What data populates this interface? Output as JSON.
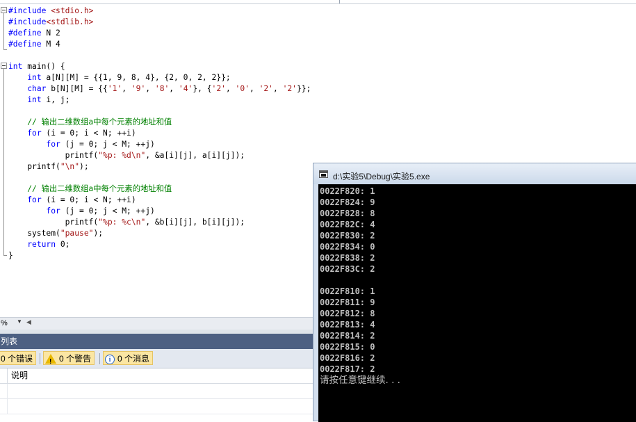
{
  "editor": {
    "lines": [
      [
        {
          "t": "#include ",
          "c": "pp"
        },
        {
          "t": "<stdio.h>",
          "c": "str"
        }
      ],
      [
        {
          "t": "#include",
          "c": "pp"
        },
        {
          "t": "<stdlib.h>",
          "c": "str"
        }
      ],
      [
        {
          "t": "#define",
          "c": "pp"
        },
        {
          "t": " N 2",
          "c": ""
        }
      ],
      [
        {
          "t": "#define",
          "c": "pp"
        },
        {
          "t": " M 4",
          "c": ""
        }
      ],
      [],
      [
        {
          "t": "int",
          "c": "kw"
        },
        {
          "t": " main() {",
          "c": ""
        }
      ],
      [
        {
          "t": "    ",
          "c": ""
        },
        {
          "t": "int",
          "c": "kw"
        },
        {
          "t": " a[N][M] = {{1, 9, 8, 4}, {2, 0, 2, 2}};",
          "c": ""
        }
      ],
      [
        {
          "t": "    ",
          "c": ""
        },
        {
          "t": "char",
          "c": "kw"
        },
        {
          "t": " b[N][M] = {{",
          "c": ""
        },
        {
          "t": "'1'",
          "c": "str"
        },
        {
          "t": ", ",
          "c": ""
        },
        {
          "t": "'9'",
          "c": "str"
        },
        {
          "t": ", ",
          "c": ""
        },
        {
          "t": "'8'",
          "c": "str"
        },
        {
          "t": ", ",
          "c": ""
        },
        {
          "t": "'4'",
          "c": "str"
        },
        {
          "t": "}, {",
          "c": ""
        },
        {
          "t": "'2'",
          "c": "str"
        },
        {
          "t": ", ",
          "c": ""
        },
        {
          "t": "'0'",
          "c": "str"
        },
        {
          "t": ", ",
          "c": ""
        },
        {
          "t": "'2'",
          "c": "str"
        },
        {
          "t": ", ",
          "c": ""
        },
        {
          "t": "'2'",
          "c": "str"
        },
        {
          "t": "}};",
          "c": ""
        }
      ],
      [
        {
          "t": "    ",
          "c": ""
        },
        {
          "t": "int",
          "c": "kw"
        },
        {
          "t": " i, j;",
          "c": ""
        }
      ],
      [],
      [
        {
          "t": "    ",
          "c": ""
        },
        {
          "t": "// 输出二维数组a中每个元素的地址和值",
          "c": "cm"
        }
      ],
      [
        {
          "t": "    ",
          "c": ""
        },
        {
          "t": "for",
          "c": "kw"
        },
        {
          "t": " (i = 0; i < N; ++i)",
          "c": ""
        }
      ],
      [
        {
          "t": "        ",
          "c": ""
        },
        {
          "t": "for",
          "c": "kw"
        },
        {
          "t": " (j = 0; j < M; ++j)",
          "c": ""
        }
      ],
      [
        {
          "t": "            printf(",
          "c": ""
        },
        {
          "t": "\"%p: %d\\n\"",
          "c": "str"
        },
        {
          "t": ", &a[i][j], a[i][j]);",
          "c": ""
        }
      ],
      [
        {
          "t": "    printf(",
          "c": ""
        },
        {
          "t": "\"\\n\"",
          "c": "str"
        },
        {
          "t": ");",
          "c": ""
        }
      ],
      [],
      [
        {
          "t": "    ",
          "c": ""
        },
        {
          "t": "// 输出二维数组a中每个元素的地址和值",
          "c": "cm"
        }
      ],
      [
        {
          "t": "    ",
          "c": ""
        },
        {
          "t": "for",
          "c": "kw"
        },
        {
          "t": " (i = 0; i < N; ++i)",
          "c": ""
        }
      ],
      [
        {
          "t": "        ",
          "c": ""
        },
        {
          "t": "for",
          "c": "kw"
        },
        {
          "t": " (j = 0; j < M; ++j)",
          "c": ""
        }
      ],
      [
        {
          "t": "            printf(",
          "c": ""
        },
        {
          "t": "\"%p: %c\\n\"",
          "c": "str"
        },
        {
          "t": ", &b[i][j], b[i][j]);",
          "c": ""
        }
      ],
      [
        {
          "t": "    system(",
          "c": ""
        },
        {
          "t": "\"pause\"",
          "c": "str"
        },
        {
          "t": ");",
          "c": ""
        }
      ],
      [
        {
          "t": "    ",
          "c": ""
        },
        {
          "t": "return",
          "c": "kw"
        },
        {
          "t": " 0;",
          "c": ""
        }
      ],
      [
        {
          "t": "}",
          "c": ""
        }
      ]
    ]
  },
  "zoom": {
    "value": "%",
    "dropdown_icon": "dropdown-arrow",
    "scroll_icon": "scroll-left-arrow"
  },
  "error_list": {
    "title": "列表",
    "errors_label": "0 个错误",
    "warnings_label": "0 个警告",
    "messages_label": "0 个消息",
    "column_description": "说明"
  },
  "console": {
    "title": "d:\\实验5\\Debug\\实验5.exe",
    "output": [
      "0022F820: 1",
      "0022F824: 9",
      "0022F828: 8",
      "0022F82C: 4",
      "0022F830: 2",
      "0022F834: 0",
      "0022F838: 2",
      "0022F83C: 2",
      "",
      "0022F810: 1",
      "0022F811: 9",
      "0022F812: 8",
      "0022F813: 4",
      "0022F814: 2",
      "0022F815: 0",
      "0022F816: 2",
      "0022F817: 2"
    ],
    "prompt": "请按任意键继续. . ."
  },
  "colors": {
    "keyword": "#0000ff",
    "string": "#a31515",
    "comment": "#008000",
    "panel_title_bg": "#4d6082",
    "filter_button_bg": "#fbe6a3",
    "console_bg": "#000000",
    "console_text": "#c0c0c0"
  }
}
